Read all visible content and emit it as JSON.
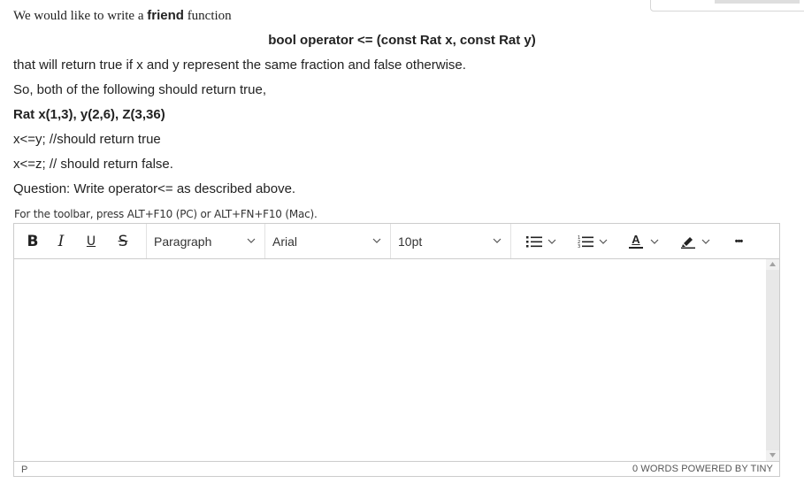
{
  "question": {
    "line1_pre": "We would like to write a ",
    "line1_bold": "friend",
    "line1_post": " function",
    "signature": "bool operator <= (const Rat x, const Rat y)",
    "line3": "that will return true if x and y represent the same fraction and false otherwise.",
    "line4": "So, both of the following should return true,",
    "line5": "Rat x(1,3), y(2,6), Z(3,36)",
    "line6": "x<=y; //should return true",
    "line7": "x<=z; // should return false.",
    "line8": "Question: Write operator<= as described above."
  },
  "editor": {
    "hint": "For the toolbar, press ALT+F10 (PC) or ALT+FN+F10 (Mac).",
    "toolbar": {
      "bold": "B",
      "italic": "I",
      "underline": "U",
      "strike": "S",
      "block_format": "Paragraph",
      "font_family": "Arial",
      "font_size": "10pt",
      "text_color_letter": "A",
      "more": "•••"
    },
    "status_path": "P",
    "word_count": "0 WORDS",
    "powered_by": "POWERED BY TINY"
  },
  "colors": {
    "text_color_bar": "#222222",
    "border": "#cccccc"
  }
}
